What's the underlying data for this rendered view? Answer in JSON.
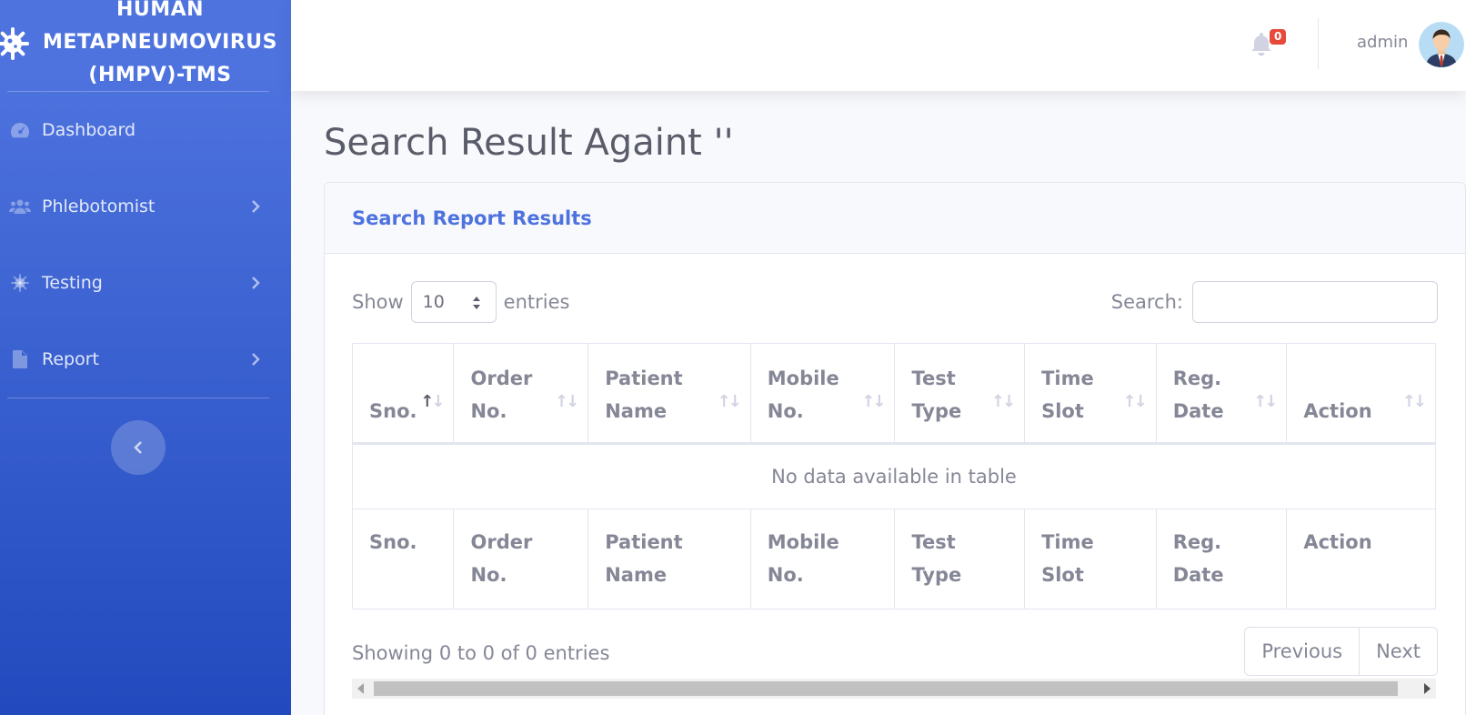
{
  "brand": {
    "title": "HUMAN METAPNEUMOVIRUS (HMPV)-TMS",
    "icon": "virus-icon"
  },
  "sidebar": {
    "items": [
      {
        "label": "Dashboard",
        "icon": "tachometer-icon",
        "has_submenu": false
      },
      {
        "label": "Phlebotomist",
        "icon": "users-icon",
        "has_submenu": true
      },
      {
        "label": "Testing",
        "icon": "virus-icon",
        "has_submenu": true
      },
      {
        "label": "Report",
        "icon": "file-icon",
        "has_submenu": true
      }
    ]
  },
  "topbar": {
    "notification_count": "0",
    "user_name": "admin"
  },
  "page": {
    "title": "Search Result Againt ''"
  },
  "card": {
    "title": "Search Report Results",
    "show_label": "Show",
    "entries_label": "entries",
    "page_length": "10",
    "search_label": "Search:",
    "search_value": "",
    "columns_header": [
      "Sno.",
      "Order No.",
      "Patient Name",
      "Mobile No.",
      "Test Type",
      "Time Slot",
      "Reg. Date",
      "Action"
    ],
    "columns_footer": [
      "Sno.",
      "Order No.",
      "Patient Name",
      "Mobile No.",
      "Test Type",
      "Time Slot",
      "Reg. Date",
      "Action"
    ],
    "empty_message": "No data available in table",
    "info": "Showing 0 to 0 of 0 entries",
    "pagination": {
      "previous": "Previous",
      "next": "Next"
    }
  },
  "colors": {
    "primary": "#4e73df",
    "primary_dark": "#224abe",
    "danger": "#e74a3b",
    "text": "#858796"
  }
}
